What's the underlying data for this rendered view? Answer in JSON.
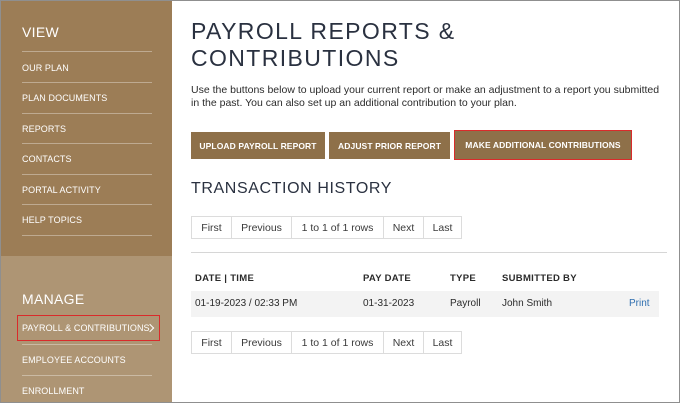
{
  "sidebar": {
    "view_heading": "VIEW",
    "view_items": [
      {
        "label": "OUR PLAN"
      },
      {
        "label": "PLAN DOCUMENTS"
      },
      {
        "label": "REPORTS"
      },
      {
        "label": "CONTACTS"
      },
      {
        "label": "PORTAL ACTIVITY"
      },
      {
        "label": "HELP TOPICS"
      }
    ],
    "manage_heading": "MANAGE",
    "manage_items": [
      {
        "label": "PAYROLL & CONTRIBUTIONS",
        "active": true
      },
      {
        "label": "EMPLOYEE ACCOUNTS"
      },
      {
        "label": "ENROLLMENT"
      }
    ]
  },
  "main": {
    "title": "PAYROLL REPORTS & CONTRIBUTIONS",
    "intro": "Use the buttons below to upload your current report or make an adjustment to a report you submitted in the past. You can also set up an additional contribution to your plan.",
    "buttons": {
      "upload": "UPLOAD PAYROLL REPORT",
      "adjust": "ADJUST PRIOR REPORT",
      "additional": "MAKE ADDITIONAL CONTRIBUTIONS"
    },
    "history_title": "TRANSACTION HISTORY",
    "pager": {
      "first": "First",
      "previous": "Previous",
      "rows": "1 to 1 of 1 rows",
      "next": "Next",
      "last": "Last"
    },
    "table": {
      "headers": {
        "date_time": "DATE | TIME",
        "pay_date": "PAY DATE",
        "type": "TYPE",
        "submitted_by": "SUBMITTED BY"
      },
      "rows": [
        {
          "date_time": "01-19-2023 / 02:33 PM",
          "pay_date": "01-31-2023",
          "type": "Payroll",
          "submitted_by": "John Smith",
          "action": "Print"
        }
      ]
    }
  },
  "colors": {
    "sidebar_view_bg": "#9c7d56",
    "sidebar_manage_bg": "#ae9574",
    "button_bg": "#8e7049",
    "highlight": "#d92b2b",
    "link": "#2f6fb0"
  }
}
